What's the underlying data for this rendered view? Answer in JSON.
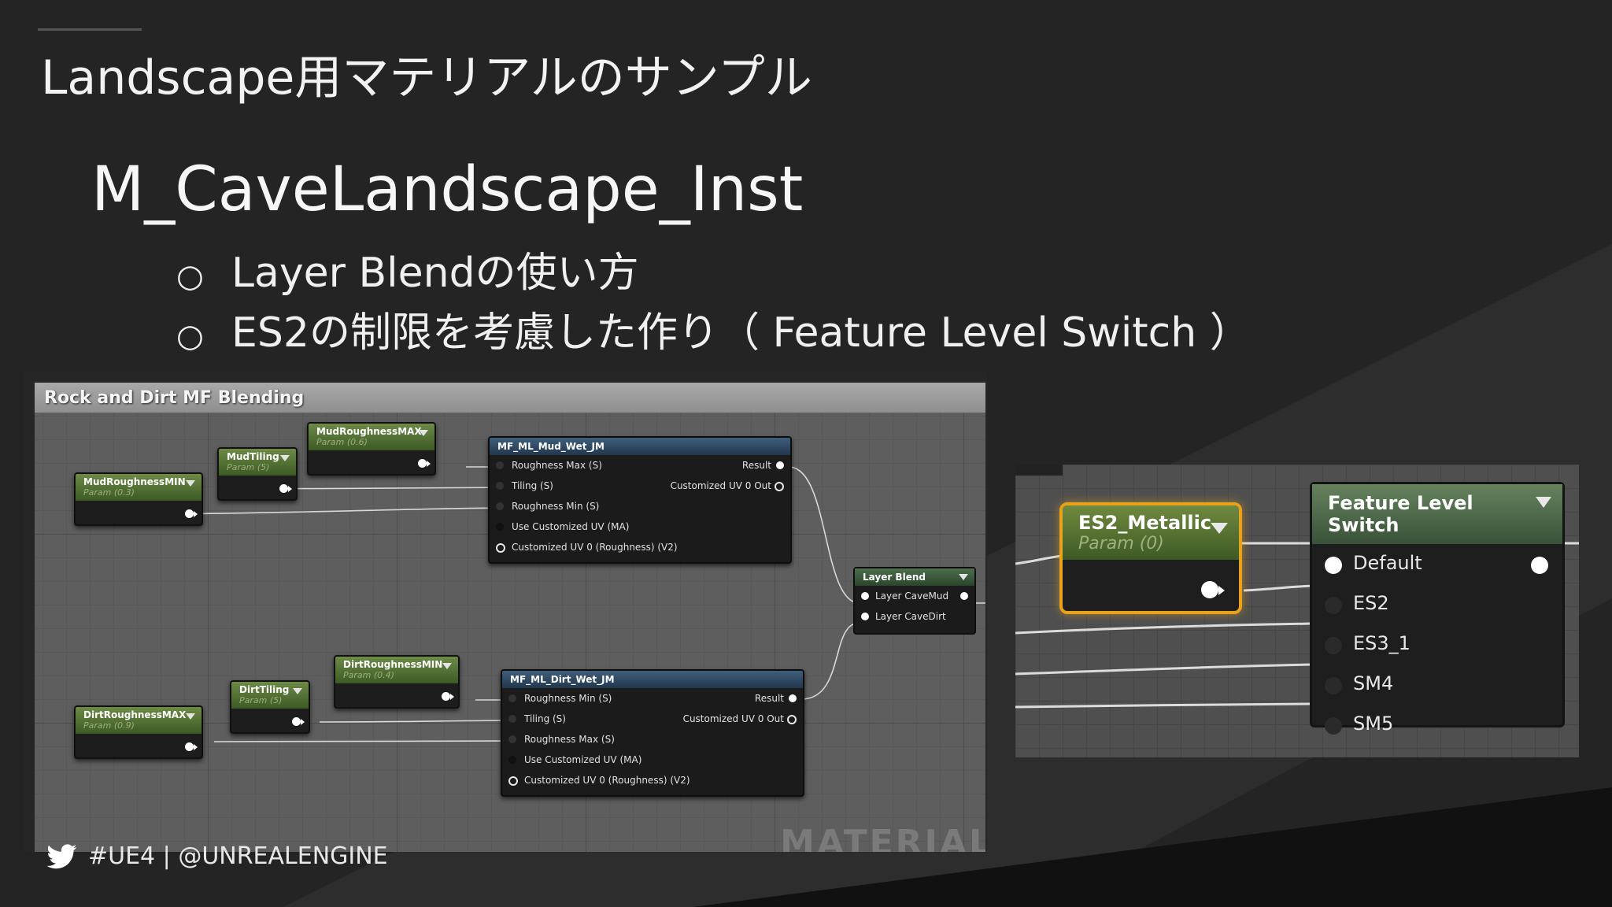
{
  "slide": {
    "title": "Landscape用マテリアルのサンプル",
    "subtitle": "M_CaveLandscape_Inst",
    "bullets": [
      {
        "mark": "○",
        "text": "Layer Blendの使い方"
      },
      {
        "mark": "○",
        "text": "ES2の制限を考慮した作り（ Feature Level Switch ）"
      }
    ],
    "footer": "#UE4 | @UNREALENGINE"
  },
  "graph": {
    "comment": "Rock and Dirt MF Blending",
    "watermark": "MATERIAL",
    "params": [
      {
        "name": "MudRoughnessMIN",
        "sub": "Param (0.3)"
      },
      {
        "name": "MudTiling",
        "sub": "Param (5)"
      },
      {
        "name": "MudRoughnessMAX",
        "sub": "Param (0.6)"
      },
      {
        "name": "DirtRoughnessMAX",
        "sub": "Param (0.9)"
      },
      {
        "name": "DirtTiling",
        "sub": "Param (5)"
      },
      {
        "name": "DirtRoughnessMIN",
        "sub": "Param (0.4)"
      }
    ],
    "mud_fn": {
      "title": "MF_ML_Mud_Wet_JM",
      "inputs": [
        "Roughness Max (S)",
        "Tiling (S)",
        "Roughness Min (S)",
        "Use Customized UV (MA)",
        "Customized UV 0 (Roughness) (V2)"
      ],
      "outputs": [
        "Result",
        "Customized UV 0 Out"
      ]
    },
    "dirt_fn": {
      "title": "MF_ML_Dirt_Wet_JM",
      "inputs": [
        "Roughness Min (S)",
        "Tiling (S)",
        "Roughness Max (S)",
        "Use Customized UV (MA)",
        "Customized UV 0 (Roughness) (V2)"
      ],
      "outputs": [
        "Result",
        "Customized UV 0 Out"
      ]
    },
    "layer_blend": {
      "title": "Layer Blend",
      "inputs": [
        "Layer CaveMud",
        "Layer CaveDirt"
      ]
    }
  },
  "crop": {
    "param": {
      "name": "ES2_Metallic",
      "sub": "Param (0)"
    },
    "switch": {
      "title": "Feature Level Switch",
      "inputs": [
        "Default",
        "ES2",
        "ES3_1",
        "SM4",
        "SM5"
      ]
    }
  },
  "colors": {
    "background": "#242424",
    "param_header": "#5a7536",
    "function_header": "#314c66",
    "selection": "#e8a21c"
  }
}
